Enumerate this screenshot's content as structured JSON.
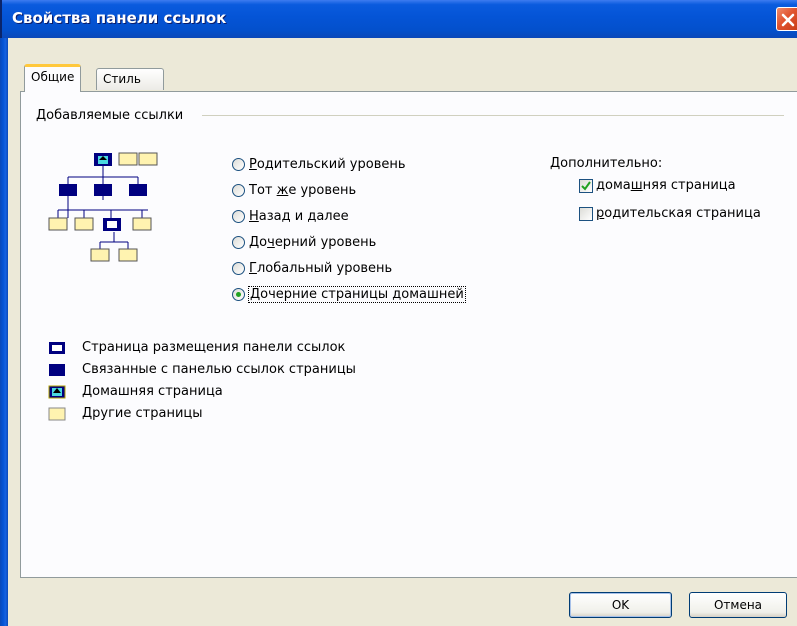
{
  "window": {
    "title": "Свойства панели ссылок"
  },
  "tabs": [
    {
      "label": "Общие",
      "selected": true
    },
    {
      "label": "Стиль",
      "selected": false
    }
  ],
  "group": {
    "label": "Добавляемые ссылки"
  },
  "radios": [
    {
      "pre": "",
      "key": "Р",
      "post": "одительский уровень",
      "selected": false
    },
    {
      "pre": "Тот ",
      "key": "ж",
      "post": "е уровень",
      "selected": false
    },
    {
      "pre": "",
      "key": "Н",
      "post": "азад и далее",
      "selected": false
    },
    {
      "pre": "До",
      "key": "ч",
      "post": "ерний уровень",
      "selected": false
    },
    {
      "pre": "",
      "key": "Г",
      "post": "лобальный уровень",
      "selected": false
    },
    {
      "pre": "",
      "key": "Д",
      "post": "очерние страницы домашней",
      "selected": true
    }
  ],
  "additional": {
    "label": "Дополнительно:",
    "home": {
      "pre": "дома",
      "key": "ш",
      "post": "няя страница",
      "checked": true
    },
    "parent": {
      "pre": "",
      "key": "р",
      "post": "одительская страница",
      "checked": false
    }
  },
  "legend": [
    {
      "label": "Страница размещения панели ссылок"
    },
    {
      "label": "Связанные с панелью ссылок страницы"
    },
    {
      "label": "Домашняя страница"
    },
    {
      "label": "Другие страницы"
    }
  ],
  "buttons": {
    "ok": "OK",
    "cancel": "Отмена"
  },
  "colors": {
    "titlebar": "#0454d6",
    "linked_page": "#000080",
    "other_page": "#fff3b0",
    "selected_radio": "#21a121",
    "check_mark": "#21a121"
  }
}
